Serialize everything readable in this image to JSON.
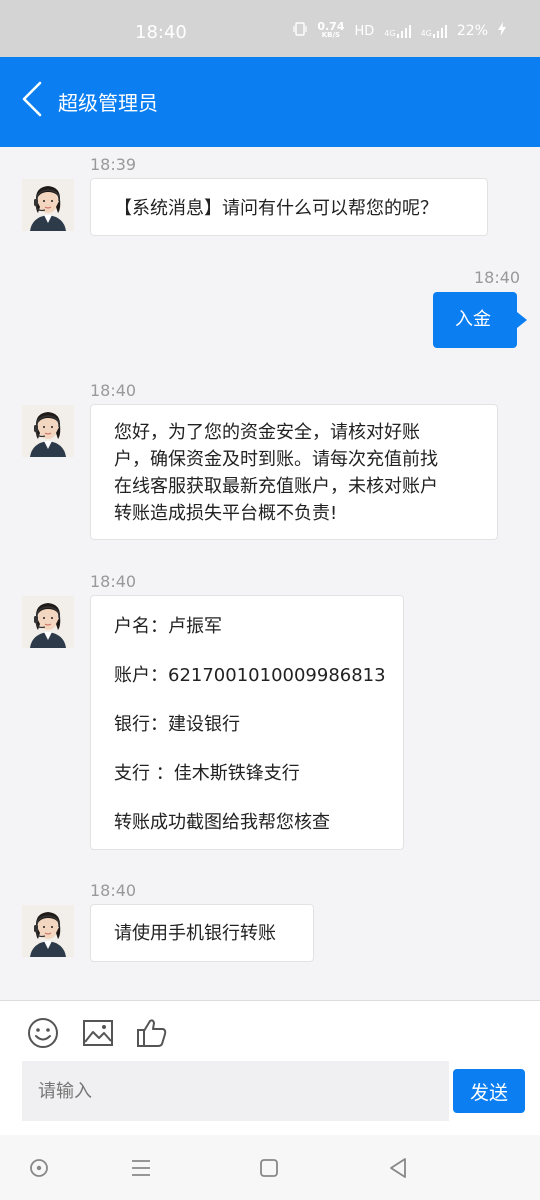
{
  "status_bar": {
    "time": "18:40",
    "net_speed_value": "0.74",
    "net_speed_unit": "KB/S",
    "hd": "HD",
    "signal1": "4G",
    "signal2": "4G",
    "battery": "22%"
  },
  "header": {
    "title": "超级管理员"
  },
  "messages": [
    {
      "time": "18:39",
      "from": "agent",
      "text": "【系统消息】请问有什么可以帮您的呢？"
    },
    {
      "time": "18:40",
      "from": "me",
      "text": "入金"
    },
    {
      "time": "18:40",
      "from": "agent",
      "lines": [
        "您好，为了您的资金安全，请核对好账",
        "户，确保资金及时到账。请每次充值前找",
        "在线客服获取最新充值账户，未核对账户",
        "转账造成损失平台概不负责!"
      ]
    },
    {
      "time": "18:40",
      "from": "agent",
      "lines": [
        "户名：卢振军",
        "账户：6217001010009986813",
        "银行：建设银行",
        "支行 ：佳木斯铁锋支行",
        "转账成功截图给我帮您核查"
      ]
    },
    {
      "time": "18:40",
      "from": "agent",
      "text": "请使用手机银行转账"
    }
  ],
  "input": {
    "placeholder": "请输入",
    "send_label": "发送"
  },
  "icons": {
    "emoji": "emoji-icon",
    "image": "image-icon",
    "like": "thumbs-up-icon",
    "back": "chevron-left-icon"
  },
  "colors": {
    "accent": "#0b7ef2"
  }
}
